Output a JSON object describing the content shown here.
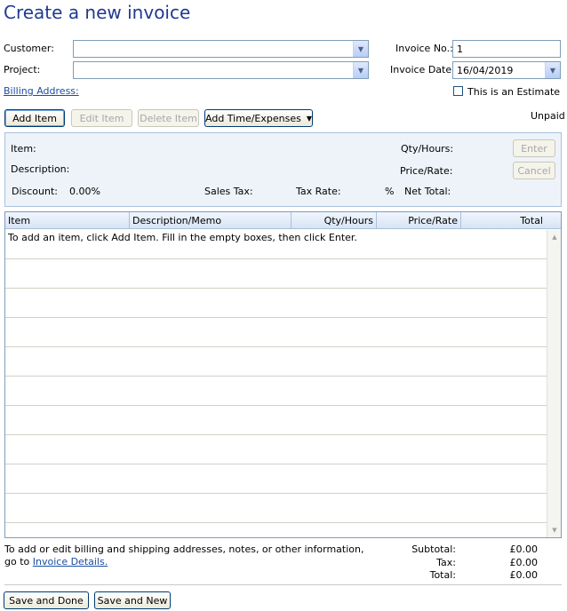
{
  "page_title": "Create a new invoice",
  "form": {
    "customer_label": "Customer:",
    "customer_value": "",
    "project_label": "Project:",
    "project_value": "",
    "billing_address_link": "Billing Address:",
    "invoice_no_label": "Invoice No.:",
    "invoice_no_value": "1",
    "invoice_date_label": "Invoice Date:",
    "invoice_date_value": "16/04/2019",
    "estimate_label": "This is an Estimate",
    "estimate_checked": false
  },
  "toolbar": {
    "add_item": "Add Item",
    "edit_item": "Edit Item",
    "delete_item": "Delete Item",
    "add_time_expenses": "Add Time/Expenses",
    "status": "Unpaid"
  },
  "item_panel": {
    "item_label": "Item:",
    "description_label": "Description:",
    "discount_label": "Discount:",
    "discount_value": "0.00%",
    "sales_tax_label": "Sales Tax:",
    "tax_rate_label": "Tax Rate:",
    "tax_rate_unit": "%",
    "net_total_label": "Net Total:",
    "qty_hours_label": "Qty/Hours:",
    "price_rate_label": "Price/Rate:",
    "enter_button": "Enter",
    "cancel_button": "Cancel"
  },
  "table": {
    "columns": [
      "Item",
      "Description/Memo",
      "Qty/Hours",
      "Price/Rate",
      "Total"
    ],
    "hint": "To add an item, click Add Item. Fill in the empty boxes, then click Enter."
  },
  "footer": {
    "info_line1": "To add or edit billing and shipping addresses, notes, or other information,",
    "info_line2_prefix": "go to",
    "invoice_details_link": "Invoice Details.",
    "subtotal_label": "Subtotal:",
    "subtotal_value": "£0.00",
    "tax_label": "Tax:",
    "tax_value": "£0.00",
    "total_label": "Total:",
    "total_value": "£0.00",
    "save_done": "Save and Done",
    "save_new": "Save and New"
  },
  "icons": {
    "dropdown": "chevron-down-icon",
    "scroll_up": "scroll-up-icon",
    "scroll_down": "scroll-down-icon"
  },
  "colors": {
    "title": "#1f3a93",
    "link": "#1a4fa0",
    "panel_bg": "#eef3fa"
  }
}
